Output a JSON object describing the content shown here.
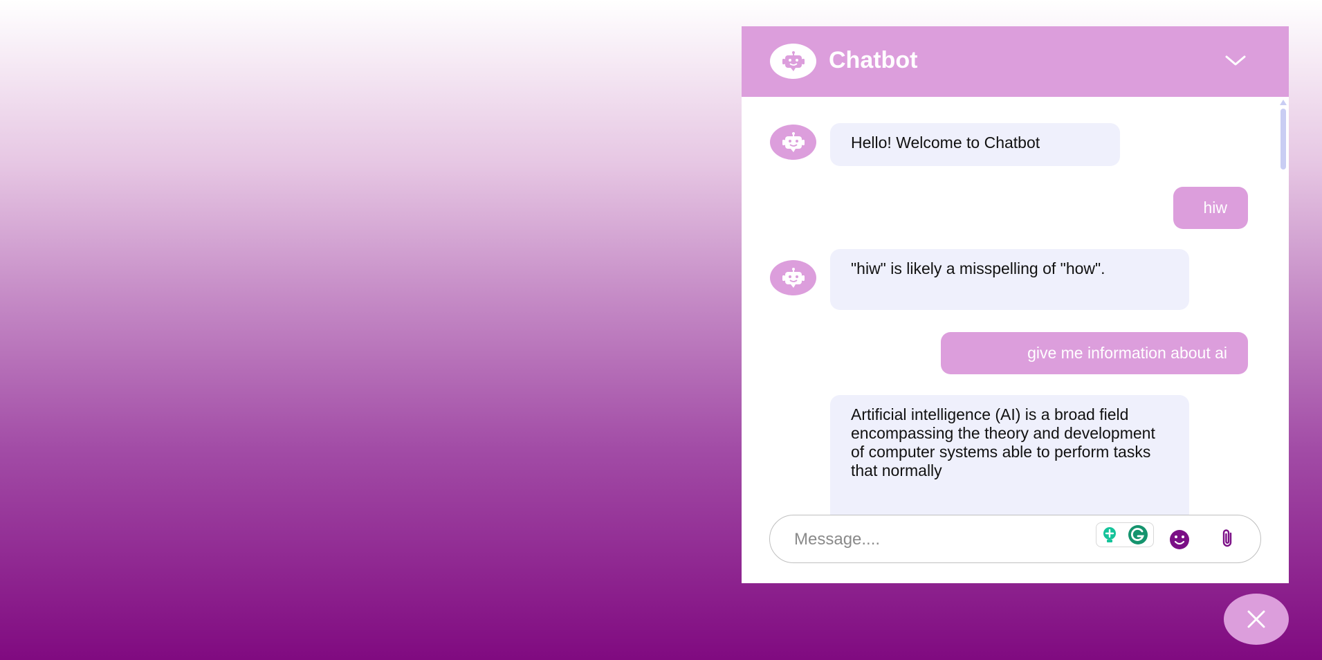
{
  "chatbot": {
    "title": "Chatbot",
    "composer_placeholder": "Message....",
    "messages": [
      {
        "role": "bot",
        "text": "Hello! Welcome to Chatbot"
      },
      {
        "role": "user",
        "text": "hiw"
      },
      {
        "role": "bot",
        "text": "\"hiw\" is likely a misspelling of \"how\"."
      },
      {
        "role": "user",
        "text": "give me information about ai"
      },
      {
        "role": "bot",
        "text": "Artificial intelligence (AI) is a broad field encompassing the theory and development of computer systems able to perform tasks that normally"
      }
    ]
  },
  "icons": {
    "bot": "robot-icon",
    "collapse": "chevron-down-icon",
    "emoji": "emoji-icon",
    "attach": "paperclip-icon",
    "close": "close-icon",
    "grammarly": "grammarly-icon"
  },
  "colors": {
    "accent": "#dc9edc",
    "bot_bubble": "#eff0fc",
    "icon_purple": "#7b0f86"
  }
}
